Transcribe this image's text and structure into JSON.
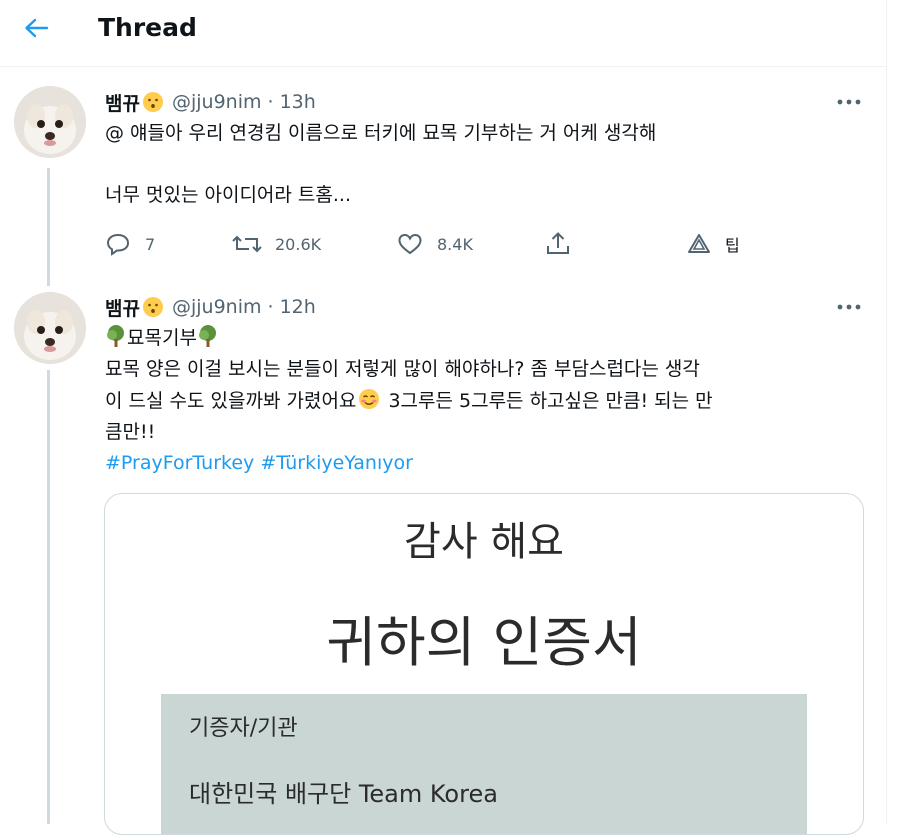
{
  "header": {
    "title": "Thread"
  },
  "tweet1": {
    "username": "뱀뀨",
    "handle": "@jju9nim",
    "time": "· 13h",
    "line1": "@ 얘들아 우리 연경킴 이름으로 터키에 묘목 기부하는 거 어케 생각해",
    "line2": "너무 멋있는 아이디어라 트홈...",
    "replies": "7",
    "retweets": "20.6K",
    "likes": "8.4K",
    "tip_label": "팁"
  },
  "tweet2": {
    "username": "뱀뀨",
    "handle": "@jju9nim",
    "time": "· 12h",
    "tree_caption": "묘목기부",
    "line1": "묘목 양은 이걸 보시는 분들이 저렇게 많이 해야하나? 좀 부담스럽다는 생각",
    "line2a": "이 드실 수도 있을까봐 가렸어요",
    "line2b": " 3그루든 5그루든 하고싶은 만큼! 되는 만",
    "line3": "큼만!!",
    "hashtag1": "#PrayForTurkey",
    "hashtag2": "#TürkiyeYanıyor"
  },
  "certificate": {
    "thanks": "감사 해요",
    "title": "귀하의 인증서",
    "donor_label": "기증자/기관",
    "donor_name": "대한민국 배구단 Team Korea"
  },
  "colors": {
    "accent": "#1d9bf0",
    "muted": "#536471",
    "cert_box": "#c9d6d3"
  }
}
